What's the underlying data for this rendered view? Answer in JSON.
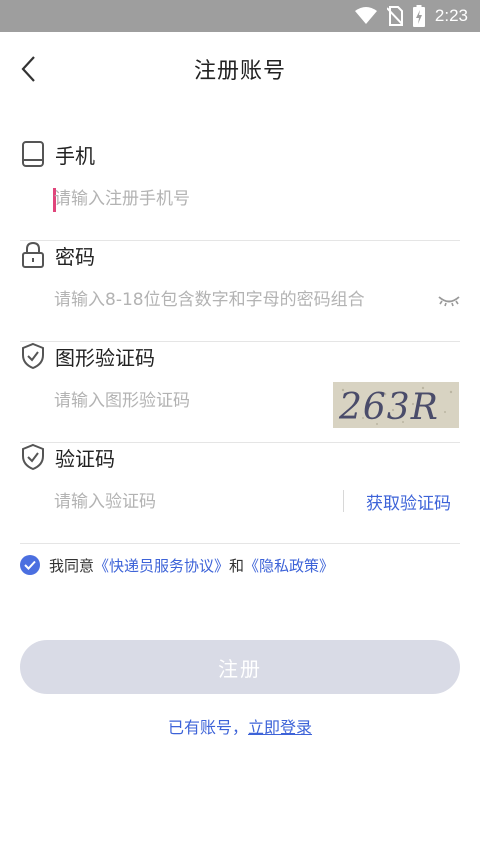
{
  "status_bar": {
    "time": "2:23",
    "icons": [
      "wifi-icon",
      "no-sim-icon",
      "battery-icon"
    ],
    "background": "#9e9e9e"
  },
  "header": {
    "title": "注册账号",
    "back_icon": "chevron-left-icon"
  },
  "form": {
    "phone": {
      "label": "手机",
      "placeholder": "请输入注册手机号",
      "icon": "phone-icon"
    },
    "password": {
      "label": "密码",
      "placeholder": "请输入8-18位包含数字和字母的密码组合",
      "icon": "lock-icon",
      "toggle_icon": "eye-closed-icon"
    },
    "captcha": {
      "label": "图形验证码",
      "placeholder": "请输入图形验证码",
      "icon": "shield-check-icon",
      "image_text": "263R"
    },
    "sms": {
      "label": "验证码",
      "placeholder": "请输入验证码",
      "icon": "shield-check-icon",
      "button_label": "获取验证码"
    }
  },
  "agreement": {
    "checked": true,
    "prefix": "我同意",
    "service_link": "《快递员服务协议》",
    "conjunction": "和",
    "privacy_link": "《隐私政策》"
  },
  "register_button": {
    "label": "注册",
    "background": "#d9dbe6"
  },
  "login": {
    "prefix": "已有账号，",
    "link_label": "立即登录"
  },
  "colors": {
    "accent": "#3d63d8",
    "checkbox": "#4b6fe0",
    "cursor": "#e0457b"
  }
}
